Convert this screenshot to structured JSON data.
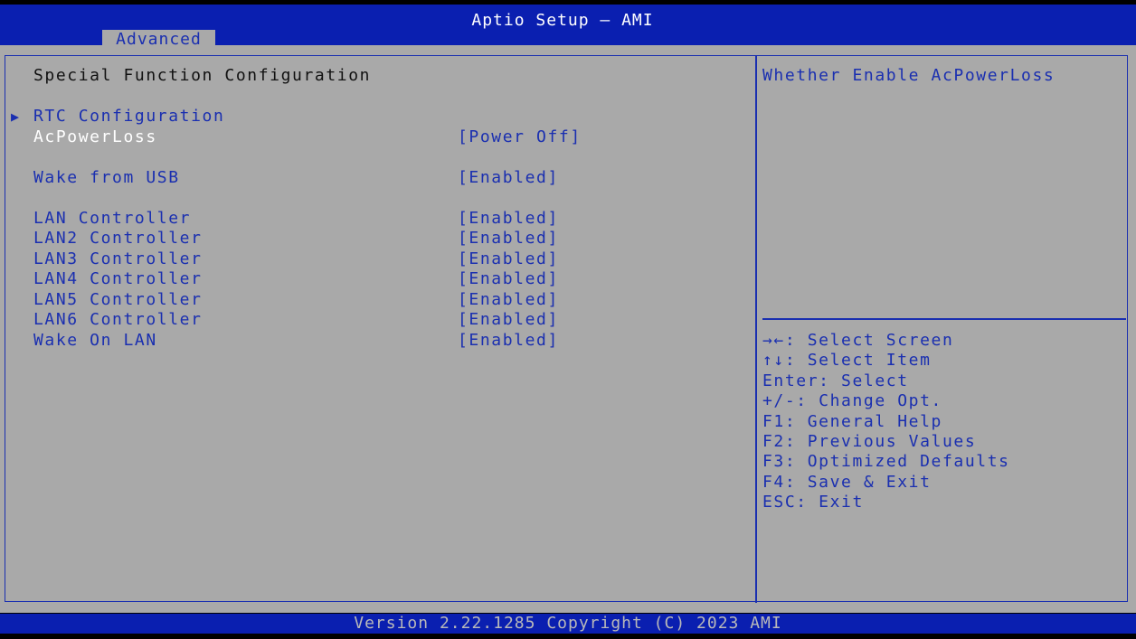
{
  "header": {
    "title": "Aptio Setup – AMI",
    "tab": "Advanced"
  },
  "page": {
    "title": "Special Function Configuration",
    "submenu": "RTC Configuration",
    "items": [
      {
        "label": "AcPowerLoss",
        "value": "[Power Off]"
      },
      {
        "label": "Wake from USB",
        "value": "[Enabled]"
      },
      {
        "label": "LAN Controller",
        "value": "[Enabled]"
      },
      {
        "label": "LAN2 Controller",
        "value": "[Enabled]"
      },
      {
        "label": "LAN3 Controller",
        "value": "[Enabled]"
      },
      {
        "label": "LAN4 Controller",
        "value": "[Enabled]"
      },
      {
        "label": "LAN5 Controller",
        "value": "[Enabled]"
      },
      {
        "label": "LAN6 Controller",
        "value": "[Enabled]"
      },
      {
        "label": "Wake On LAN",
        "value": "[Enabled]"
      }
    ]
  },
  "help": {
    "description": "Whether Enable AcPowerLoss",
    "keys": [
      "→←: Select Screen",
      "↑↓: Select Item",
      "Enter: Select",
      "+/-: Change Opt.",
      "F1: General Help",
      "F2: Previous Values",
      "F3: Optimized Defaults",
      "F4: Save & Exit",
      "ESC: Exit"
    ]
  },
  "footer": {
    "text": "Version 2.22.1285 Copyright (C) 2023 AMI"
  },
  "colors": {
    "header": "#0a1fb0",
    "panel": "#a9a9a9",
    "text": "#1a2fb0",
    "selected": "#ffffff"
  }
}
